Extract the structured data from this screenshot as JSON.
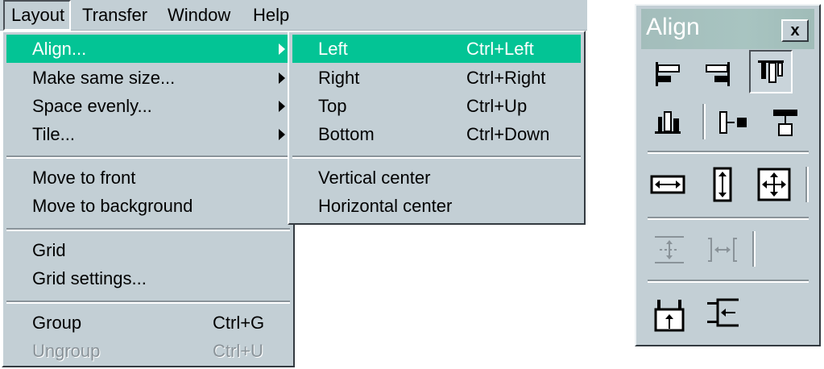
{
  "menubar": {
    "items": [
      {
        "label": "Layout"
      },
      {
        "label": "Transfer"
      },
      {
        "label": "Window"
      },
      {
        "label": "Help"
      }
    ]
  },
  "layout_menu": {
    "items": [
      {
        "label": "Align...",
        "submenu": true,
        "highlighted": true
      },
      {
        "label": "Make same size...",
        "submenu": true
      },
      {
        "label": "Space evenly...",
        "submenu": true
      },
      {
        "label": "Tile...",
        "submenu": true
      },
      {
        "label": "Move to front"
      },
      {
        "label": "Move to background"
      },
      {
        "label": "Grid"
      },
      {
        "label": "Grid settings..."
      },
      {
        "label": "Group",
        "shortcut": "Ctrl+G"
      },
      {
        "label": "Ungroup",
        "shortcut": "Ctrl+U",
        "disabled": true
      }
    ]
  },
  "align_submenu": {
    "items": [
      {
        "label": "Left",
        "shortcut": "Ctrl+Left",
        "highlighted": true
      },
      {
        "label": "Right",
        "shortcut": "Ctrl+Right"
      },
      {
        "label": "Top",
        "shortcut": "Ctrl+Up"
      },
      {
        "label": "Bottom",
        "shortcut": "Ctrl+Down"
      },
      {
        "label": "Vertical center"
      },
      {
        "label": "Horizontal center"
      }
    ]
  },
  "palette": {
    "title": "Align",
    "close_label": "x",
    "tools": [
      {
        "icon": "align-left-icon"
      },
      {
        "icon": "align-right-icon"
      },
      {
        "icon": "align-top-icon",
        "pressed": true
      },
      {
        "icon": "align-bottom-icon"
      },
      {
        "icon": "align-vertical-center-icon"
      },
      {
        "icon": "align-horizontal-center-icon"
      },
      {
        "icon": "same-width-icon"
      },
      {
        "icon": "same-height-icon"
      },
      {
        "icon": "same-size-icon"
      },
      {
        "icon": "space-evenly-vertical-icon",
        "disabled": true
      },
      {
        "icon": "space-evenly-horizontal-icon",
        "disabled": true
      },
      {
        "icon": "tile-vertical-icon"
      },
      {
        "icon": "tile-horizontal-icon"
      }
    ]
  },
  "colors": {
    "highlight": "#03c495",
    "face": "#c3cfd5",
    "title_bar": "#a8c4c1"
  }
}
